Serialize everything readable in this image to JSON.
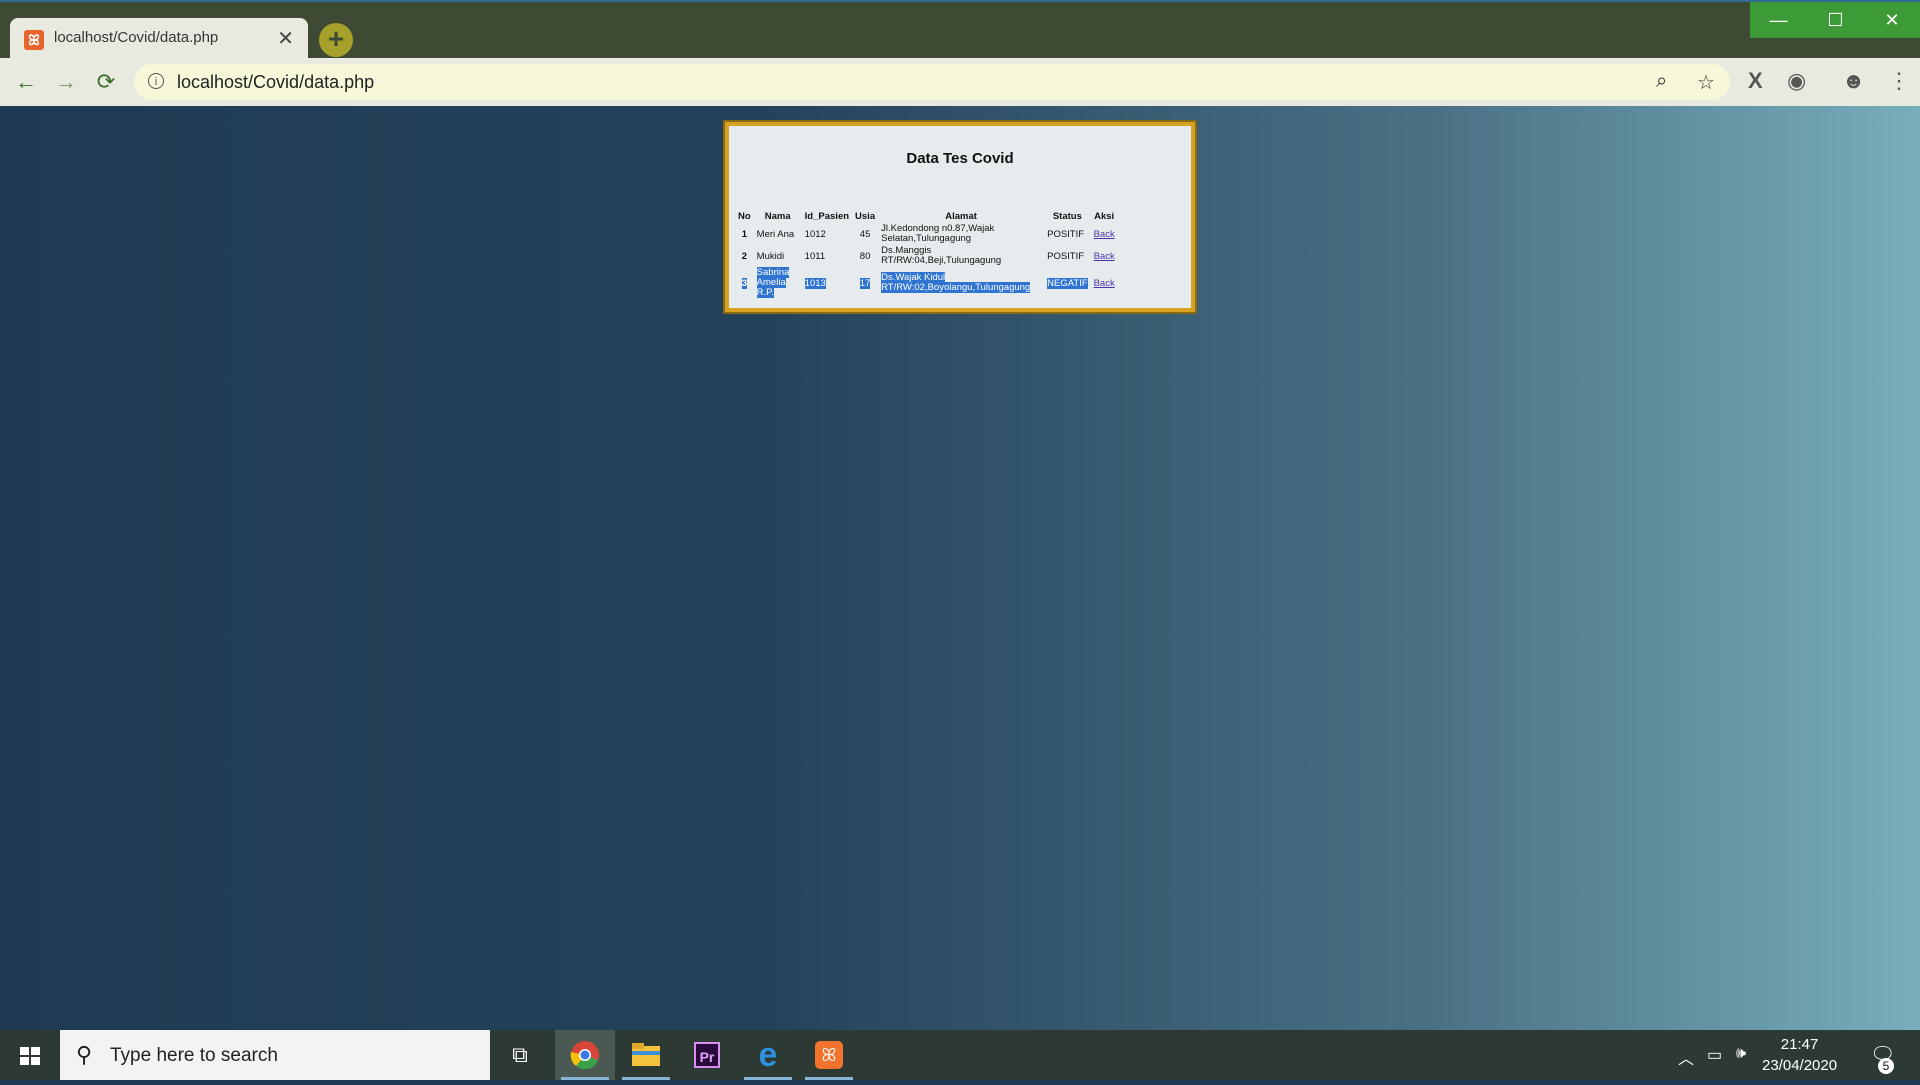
{
  "browser": {
    "tab_title": "localhost/Covid/data.php",
    "url": "localhost/Covid/data.php"
  },
  "page": {
    "heading": "Data Tes Covid",
    "columns": [
      "No",
      "Nama",
      "Id_Pasien",
      "Usia",
      "Alamat",
      "Status",
      "Aksi"
    ],
    "rows": [
      {
        "no": "1",
        "nama": "Meri Ana",
        "id": "1012",
        "usia": "45",
        "alamat": "Jl.Kedondong n0.87,Wajak Selatan,Tulungagung",
        "status": "POSITIF",
        "aksi": "Back"
      },
      {
        "no": "2",
        "nama": "Mukidi",
        "id": "1011",
        "usia": "80",
        "alamat": "Ds.Manggis RT/RW:04,Beji,Tulungagung",
        "status": "POSITIF",
        "aksi": "Back"
      },
      {
        "no": "3",
        "nama": "Sabrina Amelia R.P.",
        "id": "1013",
        "usia": "17",
        "alamat": "Ds.Wajak Kidul RT/RW:02,Boyolangu,Tulungagung",
        "status": "NEGATIF",
        "aksi": "Back"
      }
    ]
  },
  "taskbar": {
    "search_placeholder": "Type here to search",
    "time": "21:47",
    "date": "23/04/2020",
    "notification_count": "5"
  }
}
